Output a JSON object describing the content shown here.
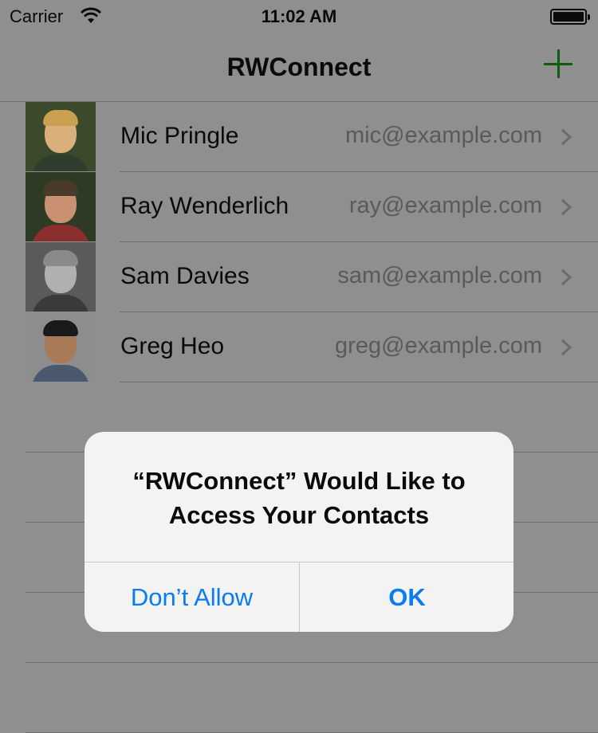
{
  "status_bar": {
    "carrier": "Carrier",
    "time": "11:02 AM",
    "wifi_icon": "wifi-icon",
    "battery_icon": "battery-icon"
  },
  "nav": {
    "title": "RWConnect",
    "add_icon": "plus-icon",
    "accent_color": "#0c5e0c"
  },
  "contacts": [
    {
      "name": "Mic Pringle",
      "email": "mic@example.com"
    },
    {
      "name": "Ray Wenderlich",
      "email": "ray@example.com"
    },
    {
      "name": "Sam Davies",
      "email": "sam@example.com"
    },
    {
      "name": "Greg Heo",
      "email": "greg@example.com"
    }
  ],
  "alert": {
    "title_line1": "“RWConnect” Would Like to",
    "title_line2": "Access Your Contacts",
    "deny_label": "Don’t Allow",
    "ok_label": "OK",
    "button_color": "#0a7bf0"
  }
}
